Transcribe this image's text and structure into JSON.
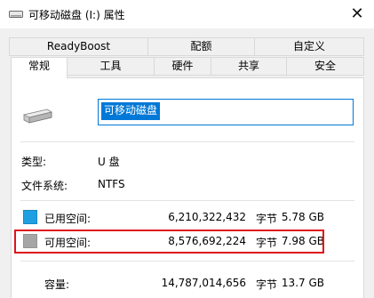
{
  "window": {
    "title": "可移动磁盘 (I:) 属性",
    "close_glyph": "✕"
  },
  "tabs_row1": [
    "ReadyBoost",
    "配额",
    "自定义"
  ],
  "tabs_row2": [
    "常规",
    "工具",
    "硬件",
    "共享",
    "安全"
  ],
  "active_tab": "常规",
  "general": {
    "drive_name": "可移动磁盘",
    "type_label": "类型:",
    "type_value": "U 盘",
    "fs_label": "文件系统:",
    "fs_value": "NTFS",
    "used": {
      "label": "已用空间:",
      "bytes": "6,210,322,432",
      "unit": "字节",
      "size": "5.78 GB"
    },
    "free": {
      "label": "可用空间:",
      "bytes": "8,576,692,224",
      "unit": "字节",
      "size": "7.98 GB"
    },
    "capacity": {
      "label": "容量:",
      "bytes": "14,787,014,656",
      "unit": "字节",
      "size": "13.7 GB"
    }
  },
  "colors": {
    "used_space": "#1fa0e2",
    "free_space": "#a6a6a6",
    "selection": "#0078d7",
    "highlight_box": "#e0141e"
  }
}
